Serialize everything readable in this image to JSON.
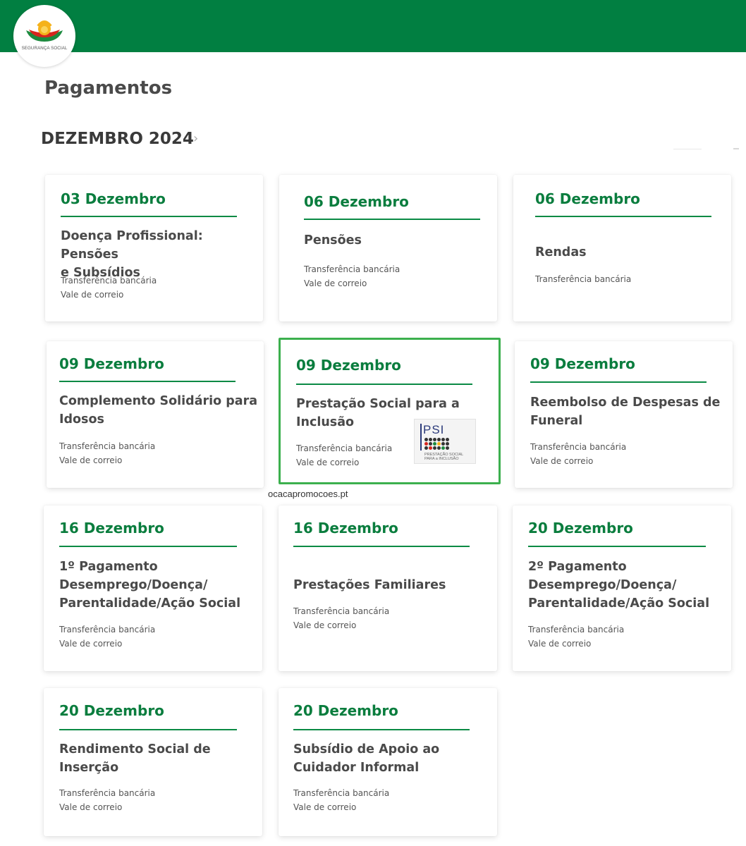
{
  "header": {
    "logo_text": "SEGURANÇA SOCIAL",
    "brand_color": "#017f41"
  },
  "page": {
    "title": "Pagamentos",
    "month": "DEZEMBRO 2024",
    "next_icon": "chevron-right-icon"
  },
  "cards": [
    {
      "date": "03 Dezembro",
      "title_lines": [
        "Doença Profissional: Pensões",
        "e Subsídios"
      ],
      "methods": [
        "Transferência bancária",
        "Vale de correio"
      ]
    },
    {
      "date": "06 Dezembro",
      "title_lines": [
        "Pensões"
      ],
      "methods": [
        "Transferência bancária",
        "Vale de correio"
      ]
    },
    {
      "date": "06 Dezembro",
      "title_lines": [
        "Rendas"
      ],
      "methods": [
        "Transferência bancária"
      ]
    },
    {
      "date": "09 Dezembro",
      "title_lines": [
        "Complemento Solidário para",
        "Idosos"
      ],
      "methods": [
        "Transferência bancária",
        "Vale de correio"
      ]
    },
    {
      "date": "09 Dezembro",
      "title_lines": [
        "Prestação Social para a",
        "Inclusão"
      ],
      "methods": [
        "Transferência bancária",
        "Vale de correio"
      ],
      "logo": {
        "text": "PSI",
        "sub_lines": [
          "PRESTAÇÃO SOCIAL",
          "PARA a INCLUSÃO"
        ]
      }
    },
    {
      "date": "09 Dezembro",
      "title_lines": [
        "Reembolso de Despesas de",
        "Funeral"
      ],
      "methods": [
        "Transferência bancária",
        "Vale de correio"
      ]
    },
    {
      "date": "16 Dezembro",
      "title_lines": [
        "1º Pagamento",
        "Desemprego/Doença/",
        "Parentalidade/Ação Social"
      ],
      "methods": [
        "Transferência bancária",
        "Vale de correio"
      ]
    },
    {
      "date": "16 Dezembro",
      "title_lines": [
        "Prestações Familiares"
      ],
      "methods": [
        "Transferência bancária",
        "Vale de correio"
      ]
    },
    {
      "date": "20 Dezembro",
      "title_lines": [
        "2º Pagamento",
        "Desemprego/Doença/",
        "Parentalidade/Ação Social"
      ],
      "methods": [
        "Transferência bancária",
        "Vale de correio"
      ]
    },
    {
      "date": "20 Dezembro",
      "title_lines": [
        "Rendimento Social de",
        "Inserção"
      ],
      "methods": [
        "Transferência bancária",
        "Vale de correio"
      ]
    },
    {
      "date": "20 Dezembro",
      "title_lines": [
        "Subsídio de Apoio ao",
        "Cuidador Informal"
      ],
      "methods": [
        "Transferência bancária",
        "Vale de correio"
      ]
    }
  ],
  "watermark": "ocacapromocoes.pt",
  "colors": {
    "accent": "#0a7d3e",
    "highlight_border": "#3cb04e"
  }
}
